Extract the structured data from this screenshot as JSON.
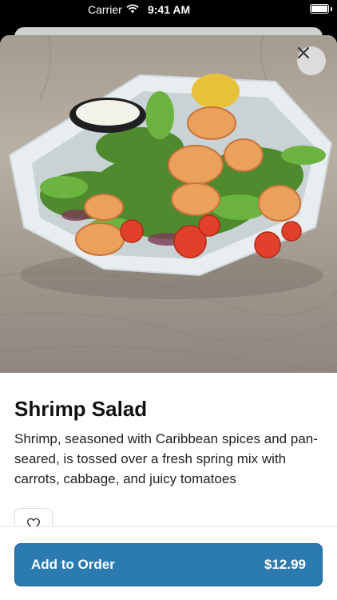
{
  "status_bar": {
    "carrier": "Carrier",
    "time": "9:41 AM"
  },
  "item": {
    "title": "Shrimp Salad",
    "description": "Shrimp, seasoned with Caribbean spices and pan-seared, is tossed over a fresh spring mix with carrots, cabbage, and juicy tomatoes",
    "image_alt": "Shrimp salad in a white bowl with dipping sauce"
  },
  "footer": {
    "button_label": "Add to Order",
    "price": "$12.99"
  },
  "colors": {
    "primary_button": "#2b7ab0"
  },
  "icons": {
    "close": "close-icon",
    "favorite": "heart-icon"
  }
}
